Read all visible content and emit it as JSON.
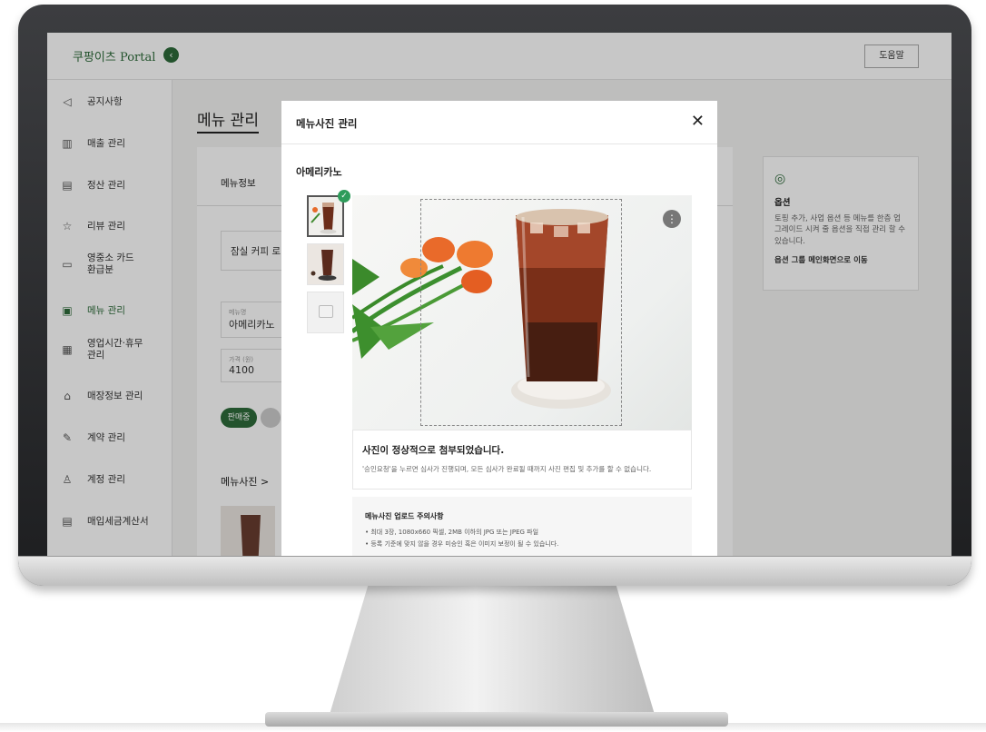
{
  "app": {
    "logo": "쿠팡이츠 Portal",
    "help_button": "도움말"
  },
  "sidebar": {
    "items": [
      {
        "label": "공지사항",
        "icon": "megaphone-icon"
      },
      {
        "label": "매출 관리",
        "icon": "bar-chart-icon"
      },
      {
        "label": "정산 관리",
        "icon": "settlement-icon"
      },
      {
        "label": "리뷰 관리",
        "icon": "star-icon"
      },
      {
        "label": "영중소 카드 환급분",
        "icon": "card-icon"
      },
      {
        "label": "메뉴 관리",
        "icon": "menu-doc-icon"
      },
      {
        "label": "영업시간·휴무 관리",
        "icon": "calendar-icon"
      },
      {
        "label": "매장정보 관리",
        "icon": "store-icon"
      },
      {
        "label": "계약 관리",
        "icon": "contract-icon"
      },
      {
        "label": "계정 관리",
        "icon": "user-icon"
      },
      {
        "label": "매입세금계산서",
        "icon": "receipt-icon"
      }
    ]
  },
  "main": {
    "title": "메뉴 관리",
    "tab_label": "메뉴정보",
    "store_name": "잠실 커피 로",
    "menu_name_label": "메뉴명",
    "menu_name_value": "아메리카노",
    "price_label": "가격 (원)",
    "price_value": "4100",
    "sale_status": "판매중",
    "photo_section": "메뉴사진 >"
  },
  "option_card": {
    "title": "옵션",
    "desc": "토핑 추가, 사업 옵션 등 메뉴를 한층 업그레이드 시켜 줄 옵션을 직접 관리 할 수 있습니다.",
    "link": "옵션 그룹 메인화면으로 이동"
  },
  "modal": {
    "title": "메뉴사진 관리",
    "menu_name": "아메리카노",
    "notice_title": "사진이 정상적으로 첨부되었습니다.",
    "notice_desc": "'승인요청'을 누르면 심사가 진행되며, 모든 심사가 완료될 때까지 사진 편집 및 추가를 할 수 없습니다.",
    "rules_title": "메뉴사진 업로드 주의사항",
    "rules": [
      "• 최대 3장, 1080x660 픽셀, 2MB 이하의 JPG 또는 JPEG 파일",
      "• 등록 기준에 맞지 않을 경우 미승인 혹은 이미지 보정이 될 수 있습니다."
    ]
  },
  "colors": {
    "brand_green": "#2e6b3a",
    "check_green": "#2e9c5b"
  }
}
